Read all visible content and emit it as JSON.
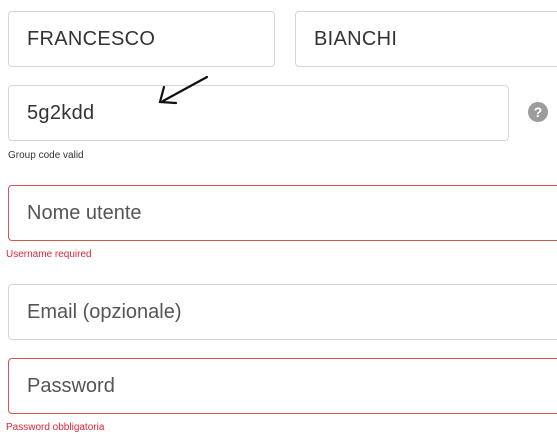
{
  "form": {
    "first_name": {
      "value": "FRANCESCO"
    },
    "last_name": {
      "value": "BIANCHI"
    },
    "group_code": {
      "value": "5g2kdd",
      "hint": "Group code valid",
      "help_icon": "question-circle-icon"
    },
    "username": {
      "placeholder": "Nome utente",
      "error": "Username required"
    },
    "email": {
      "placeholder": "Email (opzionale)"
    },
    "password": {
      "placeholder": "Password",
      "error": "Password obbligatoria"
    }
  },
  "annotation": {
    "icon": "arrow-icon"
  },
  "colors": {
    "error": "#e0243a",
    "error_border": "#d9534f",
    "border": "#d6d6d6",
    "help_icon_bg": "#9c9c9c"
  }
}
